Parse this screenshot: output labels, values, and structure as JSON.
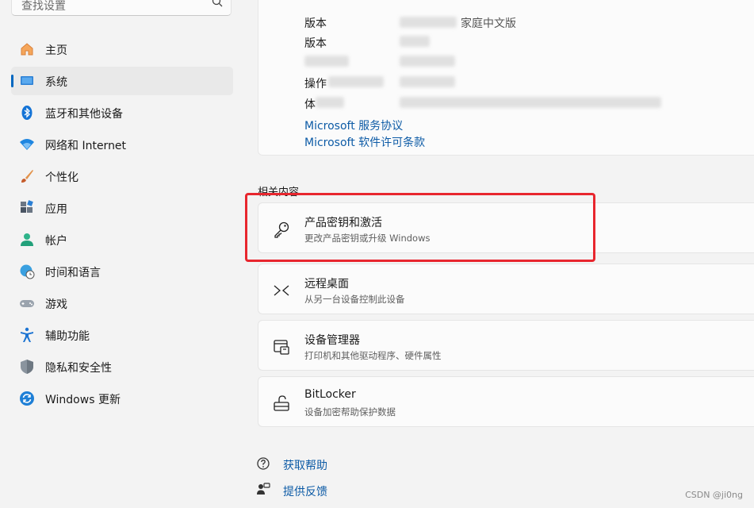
{
  "search": {
    "placeholder": "查找设置"
  },
  "sidebar": {
    "items": [
      {
        "label": "主页",
        "icon": "home-icon"
      },
      {
        "label": "系统",
        "icon": "display-icon",
        "active": true
      },
      {
        "label": "蓝牙和其他设备",
        "icon": "bluetooth-icon"
      },
      {
        "label": "网络和 Internet",
        "icon": "wifi-icon"
      },
      {
        "label": "个性化",
        "icon": "brush-icon"
      },
      {
        "label": "应用",
        "icon": "apps-icon"
      },
      {
        "label": "帐户",
        "icon": "person-icon"
      },
      {
        "label": "时间和语言",
        "icon": "globe-clock-icon"
      },
      {
        "label": "游戏",
        "icon": "gamepad-icon"
      },
      {
        "label": "辅助功能",
        "icon": "accessibility-icon"
      },
      {
        "label": "隐私和安全性",
        "icon": "shield-icon"
      },
      {
        "label": "Windows 更新",
        "icon": "update-icon"
      }
    ]
  },
  "specs": {
    "rows": [
      {
        "label": "版本",
        "value": "家庭中文版"
      },
      {
        "label": "版本",
        "value": ""
      },
      {
        "label": "",
        "value": ""
      },
      {
        "label": "操作",
        "value": ""
      },
      {
        "label": "体",
        "value": ""
      }
    ],
    "links": [
      "Microsoft 服务协议",
      "Microsoft 软件许可条款"
    ]
  },
  "related": {
    "title": "相关内容",
    "cards": [
      {
        "title": "产品密钥和激活",
        "subtitle": "更改产品密钥或升级 Windows",
        "icon": "key-icon"
      },
      {
        "title": "远程桌面",
        "subtitle": "从另一台设备控制此设备",
        "icon": "remote-desktop-icon"
      },
      {
        "title": "设备管理器",
        "subtitle": "打印机和其他驱动程序、硬件属性",
        "icon": "device-manager-icon"
      },
      {
        "title": "BitLocker",
        "subtitle": "设备加密帮助保护数据",
        "icon": "lock-icon"
      }
    ]
  },
  "footer": {
    "help": "获取帮助",
    "feedback": "提供反馈"
  },
  "watermark": "CSDN @ji0ng",
  "colors": {
    "accent": "#0067c0",
    "link": "#0d5ba6",
    "highlight": "#e8262e"
  }
}
